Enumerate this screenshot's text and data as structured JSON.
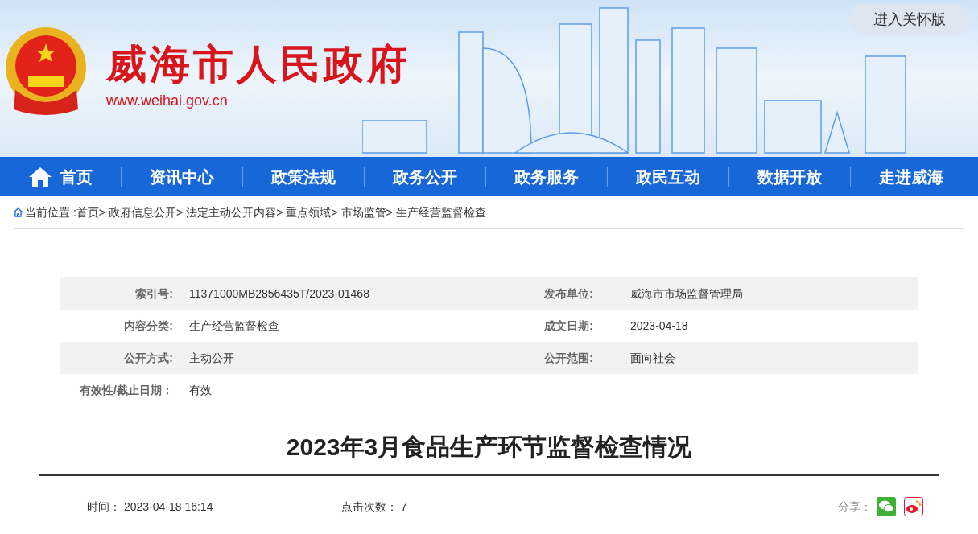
{
  "header": {
    "site_title": "威海市人民政府",
    "site_url": "www.weihai.gov.cn",
    "care_button": "进入关怀版"
  },
  "nav": [
    {
      "label": "首页"
    },
    {
      "label": "资讯中心"
    },
    {
      "label": "政策法规"
    },
    {
      "label": "政务公开"
    },
    {
      "label": "政务服务"
    },
    {
      "label": "政民互动"
    },
    {
      "label": "数据开放"
    },
    {
      "label": "走进威海"
    }
  ],
  "breadcrumb": {
    "prefix": "当前位置 :",
    "separator": ">",
    "items": [
      "首页",
      "政府信息公开",
      "法定主动公开内容",
      "重点领域",
      "市场监管",
      "生产经营监督检查"
    ]
  },
  "meta": [
    {
      "label": "索引号:",
      "value": "11371000MB2856435T/2023-01468",
      "label_2": "发布单位:",
      "value_2": "威海市市场监督管理局"
    },
    {
      "label": "内容分类:",
      "value": "生产经营监督检查",
      "label_2": "成文日期:",
      "value_2": "2023-04-18"
    },
    {
      "label": "公开方式:",
      "value": "主动公开",
      "label_2": "公开范围:",
      "value_2": "面向社会"
    },
    {
      "label": "有效性/截止日期：",
      "value": "有效"
    }
  ],
  "article": {
    "title": "2023年3月食品生产环节监督检查情况",
    "time_label": "时间：",
    "time": "2023-04-18 16:14",
    "clicks_label": "点击次数：",
    "clicks": "7",
    "share_label": "分享："
  }
}
